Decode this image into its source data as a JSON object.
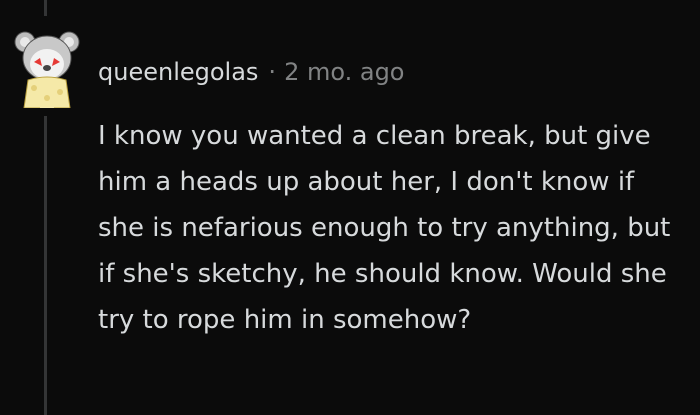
{
  "comment": {
    "avatar_icon": "koala-avatar-icon",
    "username": "queenlegolas",
    "separator": "·",
    "age": "2 mo. ago",
    "body": "I know you wanted a clean break, but give him a heads up about her, I don't know if she is nefarious enough to try anything, but if she's sketchy, he should know. Would she try to rope him in somehow?"
  },
  "colors": {
    "background": "#0b0b0b",
    "text": "#d7dadc",
    "meta": "#818384",
    "thread_line": "#343536"
  }
}
